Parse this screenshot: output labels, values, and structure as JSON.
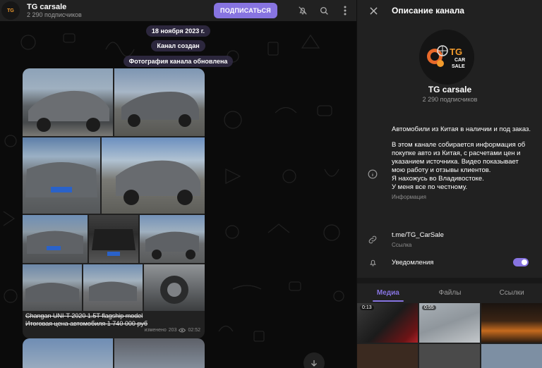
{
  "chat": {
    "avatar_text": "TG",
    "title": "TG carsale",
    "subscribers": "2 290 подписчиков",
    "join_label": "ПОДПИСАТЬСЯ",
    "service_messages": [
      "18 ноября 2023 г.",
      "Канал создан",
      "Фотография канала обновлена"
    ],
    "post": {
      "caption_line1": "Changan UNI-T 2020 1.5T flagship model",
      "caption_line2": "Итоговая цена автомобиля 1 740 000 руб",
      "edited": "изменено",
      "views": "203",
      "time": "02:52"
    }
  },
  "info": {
    "title": "Описание канала",
    "logo_line1": "TG",
    "logo_line2": "CAR",
    "logo_line3": "SALE",
    "name": "TG carsale",
    "subscribers": "2 290 подписчиков",
    "description": {
      "p1": "Автомобили из Китая в наличии и под заказ.",
      "p2": "В этом канале собирается информация об покупке авто из Китая, с расчетами цен и указанием источника. Видео показывает мою работу и отзывы клиентов.",
      "p3": "Я нахожусь во Владивостоке.",
      "p4": "У меня все по честному.",
      "label": "Информация"
    },
    "link": {
      "value": "t.me/TG_CarSale",
      "label": "Ссылка"
    },
    "notifications": {
      "label": "Уведомления",
      "enabled": true
    },
    "tabs": [
      "Медиа",
      "Файлы",
      "Ссылки"
    ],
    "active_tab": "Медиа",
    "media_durations": [
      "0:13",
      "0:55"
    ]
  },
  "colors": {
    "accent": "#8774e1",
    "panel": "#212121",
    "chat_bg": "#0b0b0b"
  }
}
